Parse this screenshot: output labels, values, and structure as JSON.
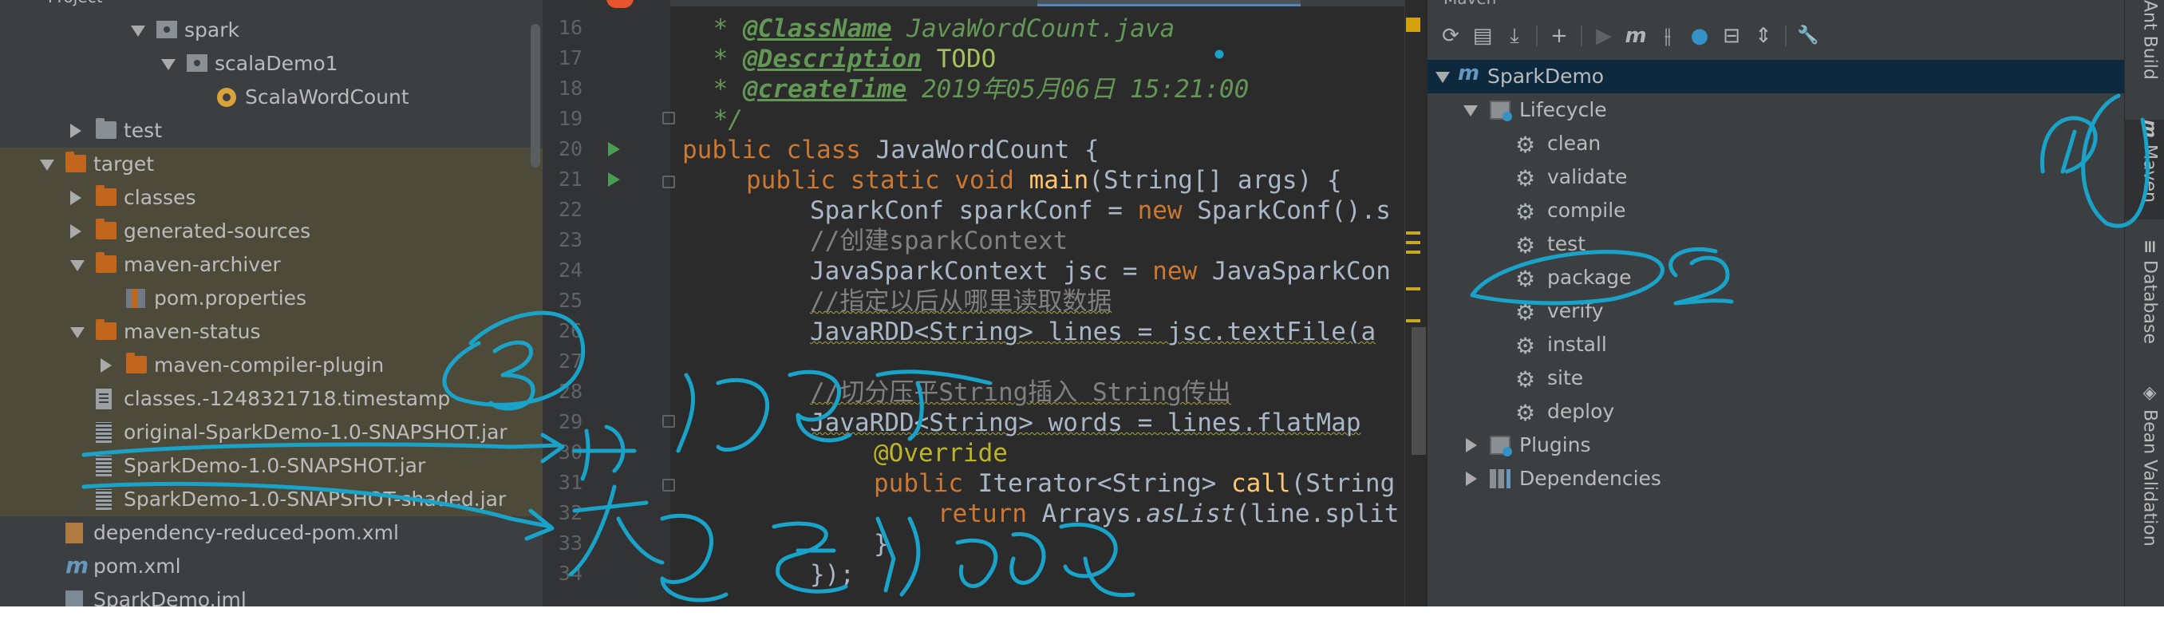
{
  "project_panel": {
    "title": "Project",
    "tree": [
      {
        "label": "spark",
        "depth": 3,
        "expanded": true,
        "icon": "package-icon"
      },
      {
        "label": "scalaDemo1",
        "depth": 4,
        "expanded": true,
        "icon": "package-icon"
      },
      {
        "label": "ScalaWordCount",
        "depth": 5,
        "icon": "scala-object-icon"
      },
      {
        "label": "test",
        "depth": 1,
        "expanded": false,
        "icon": "folder-icon"
      },
      {
        "label": "target",
        "depth": 0,
        "expanded": true,
        "icon": "folder-orange-icon"
      },
      {
        "label": "classes",
        "depth": 1,
        "expanded": false,
        "icon": "folder-orange-icon"
      },
      {
        "label": "generated-sources",
        "depth": 1,
        "expanded": false,
        "icon": "folder-orange-icon"
      },
      {
        "label": "maven-archiver",
        "depth": 1,
        "expanded": true,
        "icon": "folder-orange-icon"
      },
      {
        "label": "pom.properties",
        "depth": 2,
        "icon": "properties-icon"
      },
      {
        "label": "maven-status",
        "depth": 1,
        "expanded": true,
        "icon": "folder-orange-icon"
      },
      {
        "label": "maven-compiler-plugin",
        "depth": 2,
        "expanded": false,
        "icon": "folder-orange-icon"
      },
      {
        "label": "classes.-1248321718.timestamp",
        "depth": 1,
        "icon": "file-icon"
      },
      {
        "label": "original-SparkDemo-1.0-SNAPSHOT.jar",
        "depth": 1,
        "icon": "jar-icon"
      },
      {
        "label": "SparkDemo-1.0-SNAPSHOT.jar",
        "depth": 1,
        "icon": "jar-icon"
      },
      {
        "label": "SparkDemo-1.0-SNAPSHOT-shaded.jar",
        "depth": 1,
        "icon": "jar-icon"
      },
      {
        "label": "dependency-reduced-pom.xml",
        "depth": 0,
        "icon": "xml-icon"
      },
      {
        "label": "pom.xml",
        "depth": 0,
        "icon": "maven-icon"
      },
      {
        "label": "SparkDemo.iml",
        "depth": 0,
        "icon": "iml-icon"
      }
    ]
  },
  "editor": {
    "line_numbers": [
      "16",
      "17",
      "18",
      "19",
      "20",
      "21",
      "22",
      "23",
      "24",
      "25",
      "26",
      "27",
      "28",
      "29",
      "30",
      "31",
      "32",
      "33",
      "34"
    ],
    "code": {
      "l16_tag": "@ClassName",
      "l16_text": " JavaWordCount.java",
      "l17_tag": "@Description",
      "l17_text": " TODO",
      "l18_tag": "@createTime",
      "l18_text": " 2019年05月06日 15:21:00",
      "l19": " */",
      "l20_kw": "public class",
      "l20_rest": " JavaWordCount {",
      "l21_kw": "public static void",
      "l21_fn": "main",
      "l21_rest": "(String[] args) {",
      "l22_a": "SparkConf sparkConf = ",
      "l22_kw": "new",
      "l22_b": " SparkConf().s",
      "l23": "//创建sparkContext",
      "l24_a": "JavaSparkContext jsc = ",
      "l24_kw": "new",
      "l24_b": " JavaSparkCon",
      "l25": "//指定以后从哪里读取数据",
      "l26": "JavaRDD<String> lines = jsc.textFile(a",
      "l28": "//切分压平String插入 String传出",
      "l29": "JavaRDD<String> words = lines.flatMap",
      "l30": "@Override",
      "l31_kw": "public",
      "l31_a": " Iterator<String> ",
      "l31_fn": "call",
      "l31_b": "(String",
      "l32_kw": "return",
      "l32_a": " Arrays.",
      "l32_it": "asList",
      "l32_b": "(line.split",
      "l33": "}",
      "l34": "});"
    }
  },
  "maven_panel": {
    "title": "Maven",
    "toolbar": [
      "refresh-icon",
      "add-maven-project-icon",
      "download-icon",
      "plus-icon",
      "run-icon",
      "execute-goal-icon",
      "toggle-offline-icon",
      "skip-tests-icon",
      "show-dependencies-icon",
      "collapse-all-icon",
      "settings-wrench-icon"
    ],
    "toolbar_glyphs": {
      "refresh": "⟳",
      "reimport": "▤",
      "download": "⤓",
      "plus": "+",
      "run": "▶",
      "m": "m",
      "offline": "⫲",
      "skip": "●",
      "deps": "⊟",
      "collapse": "⇕",
      "wrench": "🔧"
    },
    "root": "SparkDemo",
    "lifecycle_label": "Lifecycle",
    "lifecycle": [
      "clean",
      "validate",
      "compile",
      "test",
      "package",
      "verify",
      "install",
      "site",
      "deploy"
    ],
    "plugins_label": "Plugins",
    "dependencies_label": "Dependencies"
  },
  "side_strip": {
    "tabs": [
      {
        "label": "Ant Build",
        "icon": "ant-icon"
      },
      {
        "label": "Maven",
        "icon": "m",
        "active": true
      },
      {
        "label": "Database",
        "icon": "database-icon"
      },
      {
        "label": "Bean Validation",
        "icon": "bean-icon"
      }
    ]
  },
  "annotations": {
    "marks": [
      "①",
      "②",
      "③"
    ],
    "note_small_package": "小包",
    "note_big_package": "大包全部jar包",
    "ink_color": "#1aa3c9"
  }
}
